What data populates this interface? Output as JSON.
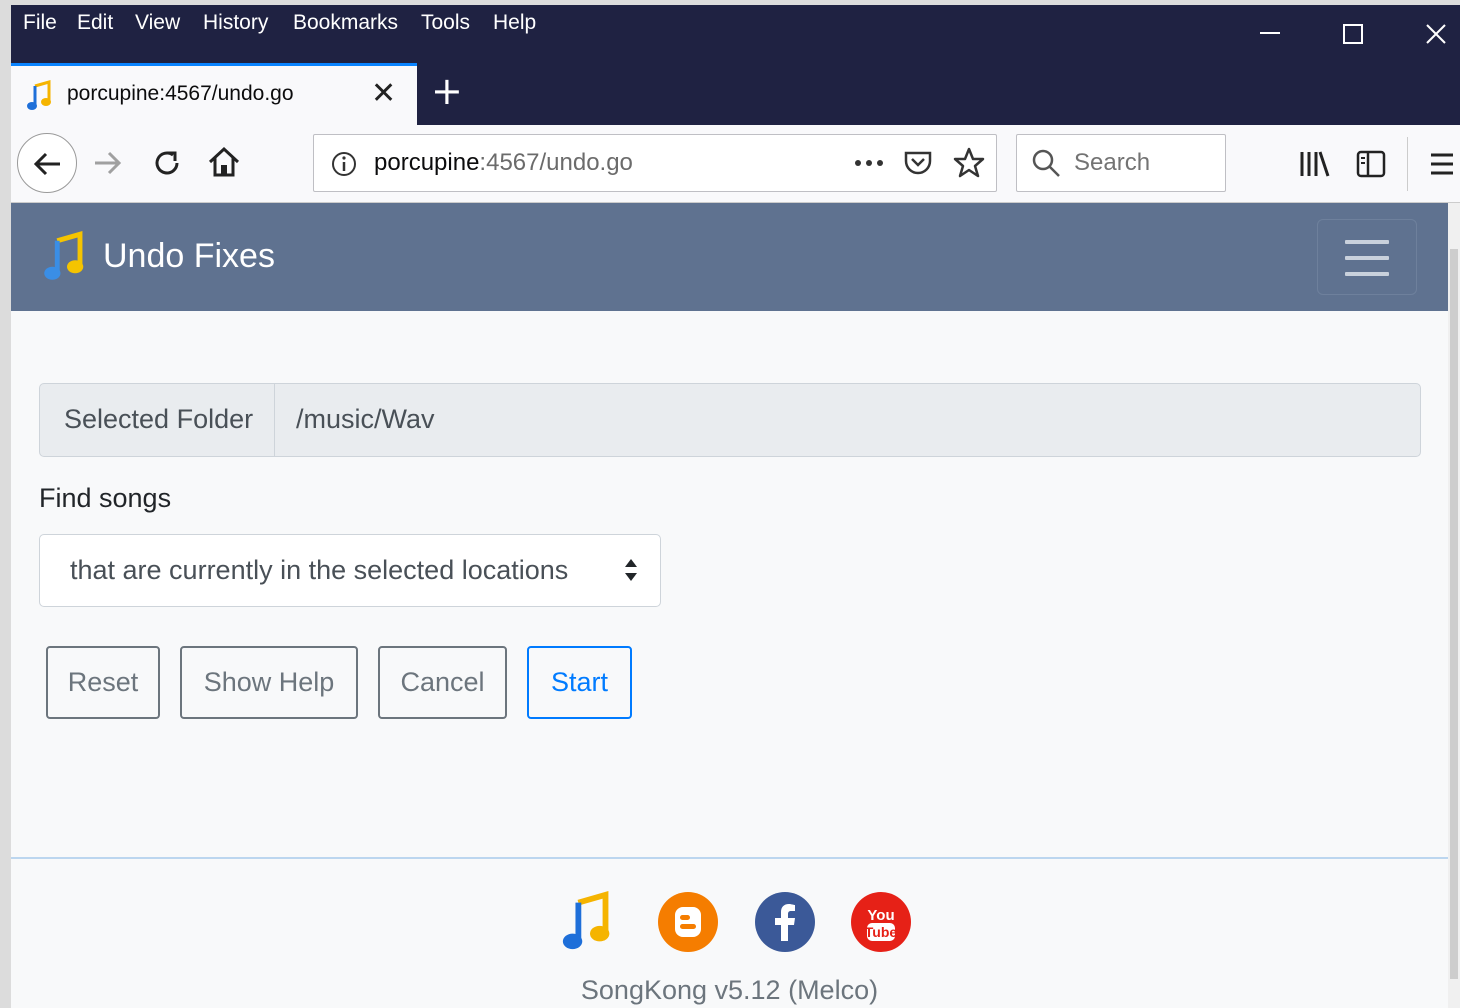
{
  "menubar": {
    "items": [
      "File",
      "Edit",
      "View",
      "History",
      "Bookmarks",
      "Tools",
      "Help"
    ]
  },
  "tab": {
    "title": "porcupine:4567/undo.go"
  },
  "navbar": {
    "url_host": "porcupine",
    "url_rest": ":4567/undo.go",
    "search_placeholder": "Search"
  },
  "app": {
    "title": "Undo Fixes"
  },
  "form": {
    "folder_label": "Selected Folder",
    "folder_value": "/music/Wav",
    "find_label": "Find songs",
    "find_selected": "that are currently in the selected locations"
  },
  "buttons": {
    "reset": "Reset",
    "show_help": "Show Help",
    "cancel": "Cancel",
    "start": "Start"
  },
  "footer": {
    "version": "SongKong v5.12 (Melco)"
  },
  "colors": {
    "header_bg": "#5f7290",
    "primary": "#007bff",
    "secondary": "#6c757d",
    "blogger": "#f57d00",
    "facebook": "#3b5998",
    "youtube": "#e62117"
  }
}
